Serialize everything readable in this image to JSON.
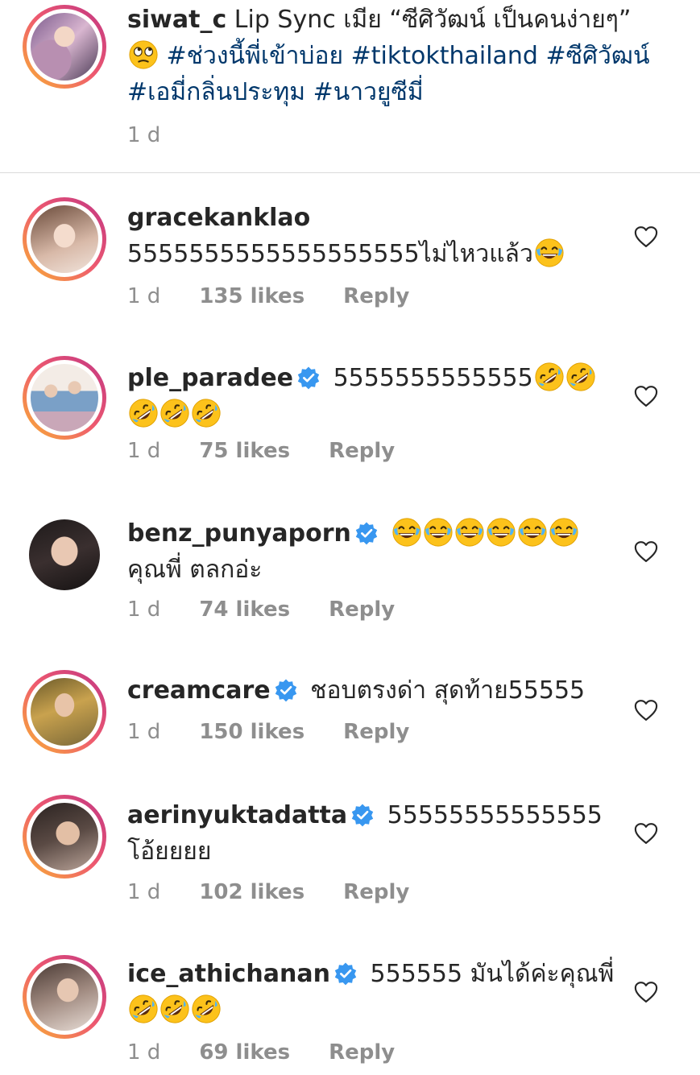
{
  "caption": {
    "username": "siwat_c",
    "text": " Lip Sync เมีย “ซีศิวัฒน์ เป็นคนง่ายๆ”",
    "hashtags": "#ช่วงนี้พี่เข้าบ่อย #tiktokthailand #ซีศิวัฒน์ #เอมี่กลิ่นประทุม #นาวยูซีมี่",
    "time": "1 d",
    "emoji": "eye-roll-emoji"
  },
  "comments": [
    {
      "username": "gracekanklao",
      "verified": false,
      "text": "5555555555555555555ไม่ไหวแล้ว",
      "time": "1 d",
      "likes": "135 likes",
      "reply": "Reply"
    },
    {
      "username": "ple_paradee",
      "verified": true,
      "text": "5555555555555",
      "time": "1 d",
      "likes": "75 likes",
      "reply": "Reply"
    },
    {
      "username": "benz_punyaporn",
      "verified": true,
      "text": "คุณพี่ ตลกอ่ะ",
      "time": "1 d",
      "likes": "74 likes",
      "reply": "Reply"
    },
    {
      "username": "creamcare",
      "verified": true,
      "text": "ชอบตรงด่า สุดท้าย55555",
      "time": "1 d",
      "likes": "150 likes",
      "reply": "Reply"
    },
    {
      "username": "aerinyuktadatta",
      "verified": true,
      "text": "55555555555555 โอ้ยยยย",
      "time": "1 d",
      "likes": "102 likes",
      "reply": "Reply"
    },
    {
      "username": "ice_athichanan",
      "verified": true,
      "text": "555555 มันได้ค่ะคุณพี่",
      "time": "1 d",
      "likes": "69 likes",
      "reply": "Reply"
    }
  ],
  "colors": {
    "link": "#00376b",
    "meta": "#8e8e8e",
    "verified": "#3897f0",
    "ring_start": "#f9b233",
    "ring_end": "#c13584"
  }
}
